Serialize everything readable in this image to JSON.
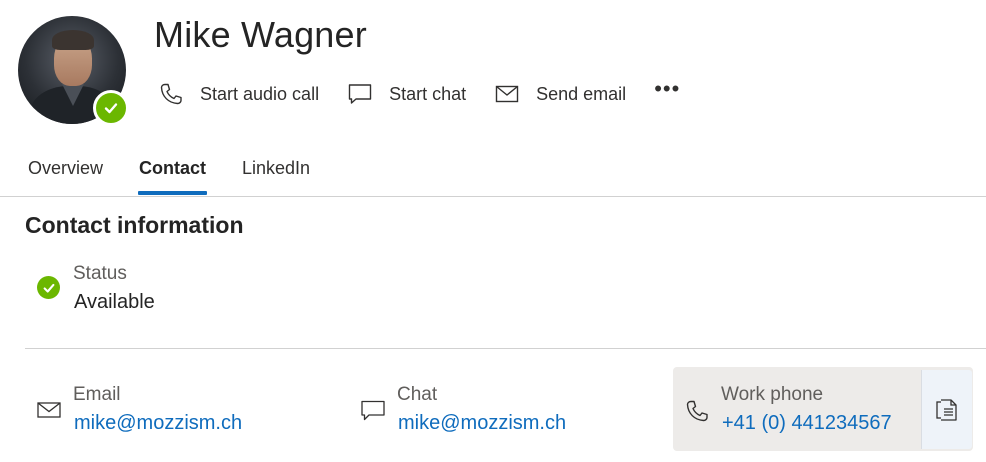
{
  "profile": {
    "name": "Mike Wagner",
    "presence": "available"
  },
  "actions": {
    "audio_call": "Start audio call",
    "chat": "Start chat",
    "email": "Send email",
    "more": "•••"
  },
  "tabs": [
    {
      "label": "Overview",
      "active": false
    },
    {
      "label": "Contact",
      "active": true
    },
    {
      "label": "LinkedIn",
      "active": false
    }
  ],
  "contact": {
    "title": "Contact information",
    "status": {
      "label": "Status",
      "value": "Available"
    },
    "email": {
      "label": "Email",
      "value": "mike@mozzism.ch"
    },
    "chat": {
      "label": "Chat",
      "value": "mike@mozzism.ch"
    },
    "work_phone": {
      "label": "Work phone",
      "value": "+41 (0) 441234567"
    }
  },
  "colors": {
    "accent": "#0f6cbd",
    "presence_green": "#6bb700",
    "text": "#323130",
    "muted": "#605e5c"
  },
  "icons": [
    "phone-icon",
    "chat-icon",
    "mail-icon",
    "more-icon",
    "check-icon",
    "copy-icon"
  ]
}
